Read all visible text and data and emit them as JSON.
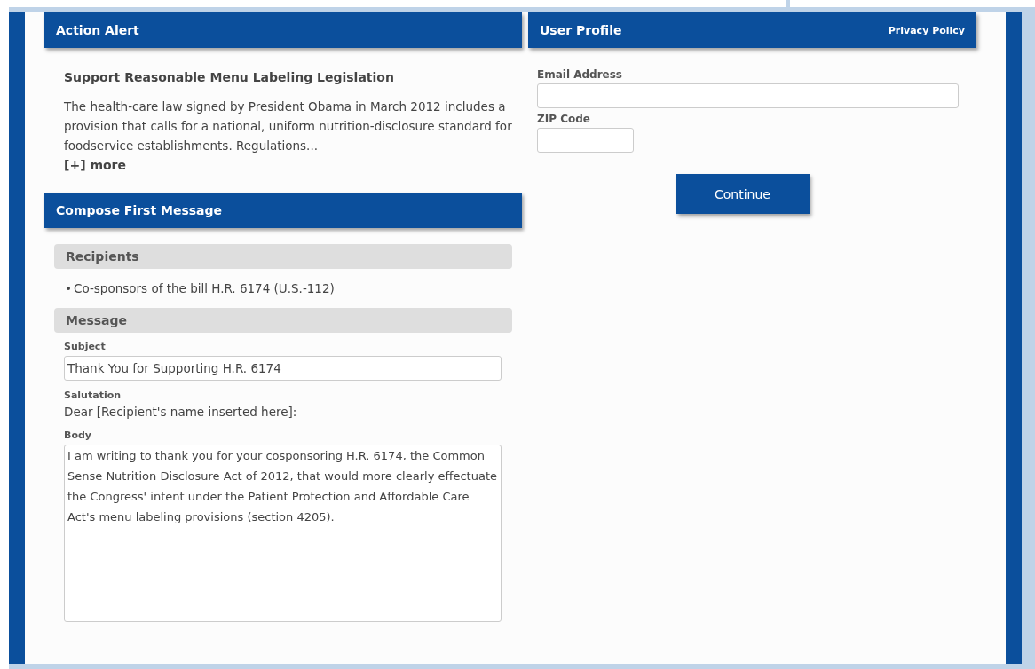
{
  "action_alert": {
    "title": "Action Alert",
    "headline": "Support Reasonable Menu Labeling Legislation",
    "summary": "The health-care law signed by President Obama in March 2012 includes a provision that calls for a national, uniform nutrition-disclosure standard for foodservice establishments. Regulations...",
    "more_link": "[+] more"
  },
  "compose": {
    "title": "Compose First Message",
    "recipients": {
      "heading": "Recipients",
      "items": [
        "Co-sponsors of the bill H.R. 6174 (U.S.-112)"
      ]
    },
    "message": {
      "heading": "Message",
      "subject": {
        "label": "Subject",
        "value": "Thank You for Supporting H.R. 6174"
      },
      "salutation": {
        "label": "Salutation",
        "text": "Dear [Recipient's name inserted here]:"
      },
      "body": {
        "label": "Body",
        "value": "I am writing to thank you for your cosponsoring H.R. 6174, the Common Sense Nutrition Disclosure Act of 2012, that would more clearly effectuate the Congress' intent under the Patient Protection and Affordable Care Act's menu labeling provisions (section 4205)."
      }
    }
  },
  "user_profile": {
    "title": "User Profile",
    "privacy_link": "Privacy Policy",
    "fields": [
      {
        "label": "Email Address",
        "kind": "wide"
      },
      {
        "label": "ZIP Code",
        "kind": "short"
      }
    ],
    "submit": "Continue"
  }
}
